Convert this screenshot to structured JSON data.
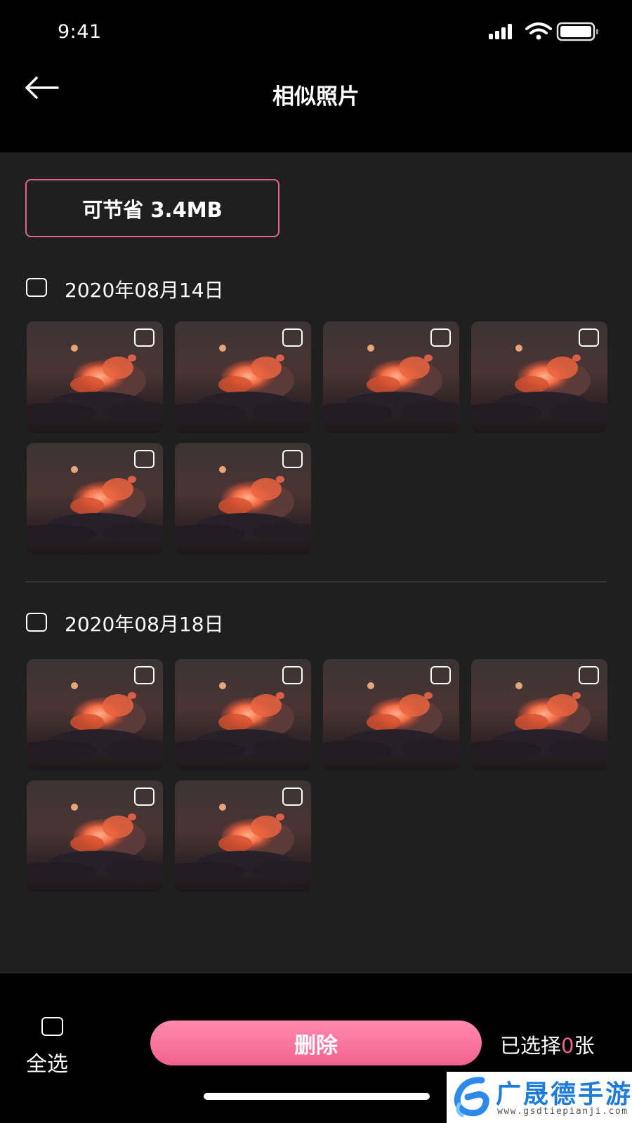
{
  "status_bar": {
    "time": "9:41"
  },
  "header": {
    "title": "相似照片"
  },
  "savings": {
    "label": "可节省 3.4MB"
  },
  "groups": [
    {
      "date": "2020年08月14日",
      "photo_count": 6
    },
    {
      "date": "2020年08月18日",
      "photo_count": 6
    }
  ],
  "bottom_bar": {
    "select_all_label": "全选",
    "delete_label": "删除",
    "selected_prefix": "已选择",
    "selected_count": "0",
    "selected_suffix": "张"
  },
  "watermark": {
    "title": "广晟德手游",
    "url": "www.gsdtiepianji.com"
  },
  "colors": {
    "accent": "#f2628f",
    "background": "#000000",
    "content_bg": "#1f1f1f",
    "watermark_blue": "#1f7bd8"
  }
}
